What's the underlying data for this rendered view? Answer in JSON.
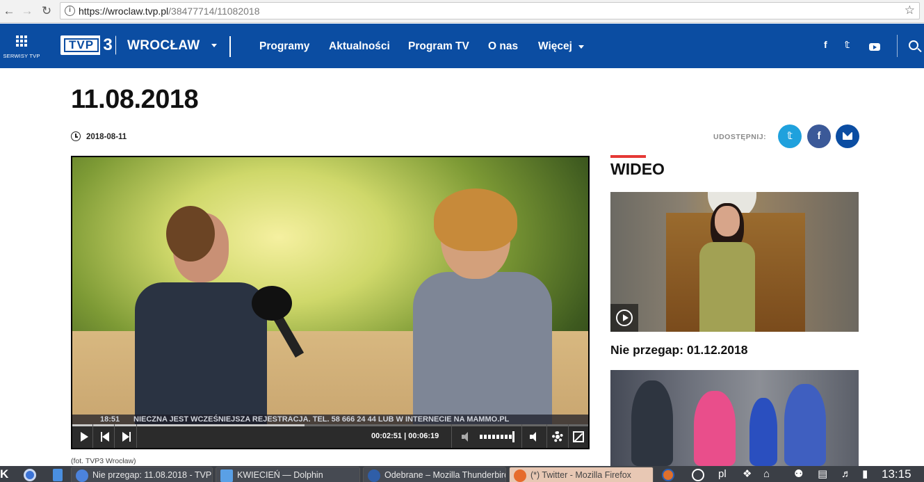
{
  "browser": {
    "url_host": "https://wroclaw.tvp.pl",
    "url_path": "/38477714/11082018"
  },
  "header": {
    "serwisy_label": "SERWISY TVP",
    "logo_text": "TVP",
    "logo_number": "3",
    "region": "WROCŁAW",
    "menu": [
      "Programy",
      "Aktualności",
      "Program TV",
      "O nas",
      "Więcej"
    ],
    "social": [
      "f",
      "𝕥"
    ],
    "brand_color": "#0b4da2"
  },
  "article": {
    "title": "11.08.2018",
    "date": "2018-08-11",
    "share_label": "UDOSTĘPNIJ:",
    "caption": "(fot. TVP3 Wrocław)"
  },
  "player": {
    "ticker_time": "18:51",
    "ticker_text": "NIECZNA JEST WCZEŚNIEJSZA REJESTRACJA. TEL. 58 666 24 44 LUB W INTERNECIE NA MAMMO.PL",
    "time_display": "00:02:51 | 00:06:19",
    "progress": 0.45
  },
  "sidebar": {
    "section_title": "WIDEO",
    "items": [
      {
        "title": "Nie przegap: 01.12.2018"
      }
    ],
    "accent_color": "#e53935"
  },
  "taskbar": {
    "kmenu": "K",
    "tasks": [
      "Nie przegap: 11.08.2018 - TVP",
      "KWIECIEŃ — Dolphin",
      "Odebrane – Mozilla Thunderbird",
      "(*) Twitter - Mozilla Firefox"
    ],
    "lang": "pl",
    "clock": "13:15"
  }
}
